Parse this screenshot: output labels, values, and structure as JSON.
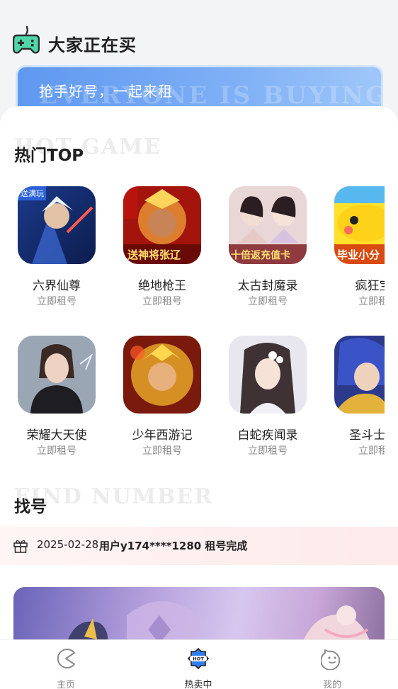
{
  "header": {
    "title": "大家正在买",
    "banner_text": "抢手好号，一起来租",
    "banner_watermark": "EVERYONE IS BUYING"
  },
  "hot": {
    "watermark": "HOT GAME",
    "title": "热门TOP",
    "rows": [
      [
        {
          "name": "六界仙尊",
          "sub": "立即租号",
          "cover_text": "送满玩"
        },
        {
          "name": "绝地枪王",
          "sub": "立即租号",
          "cover_text": "送神将张辽"
        },
        {
          "name": "太古封魔录",
          "sub": "立即租号",
          "cover_text": "十倍返充值卡"
        },
        {
          "name": "疯狂宝",
          "sub": "立即租",
          "cover_text": "毕业小分"
        }
      ],
      [
        {
          "name": "荣耀大天使",
          "sub": "立即租号",
          "cover_text": ""
        },
        {
          "name": "少年西游记",
          "sub": "立即租号",
          "cover_text": ""
        },
        {
          "name": "白蛇疾闻录",
          "sub": "立即租号",
          "cover_text": ""
        },
        {
          "name": "圣斗士星",
          "sub": "立即租",
          "cover_text": ""
        }
      ]
    ]
  },
  "find": {
    "watermark": "FIND NUMBER",
    "title": "找号",
    "notice_date": "2025-02-28",
    "notice_text": "用户y174****1280 租号完成"
  },
  "tabbar": {
    "tabs": [
      {
        "label": "主页",
        "icon": "pacman-icon"
      },
      {
        "label": "热卖中",
        "icon": "hot-badge-icon"
      },
      {
        "label": "我的",
        "icon": "face-icon"
      }
    ],
    "hot_badge_text": "HOT"
  },
  "colors": {
    "accent": "#5f98f0",
    "logo_green": "#4fd6a8"
  }
}
